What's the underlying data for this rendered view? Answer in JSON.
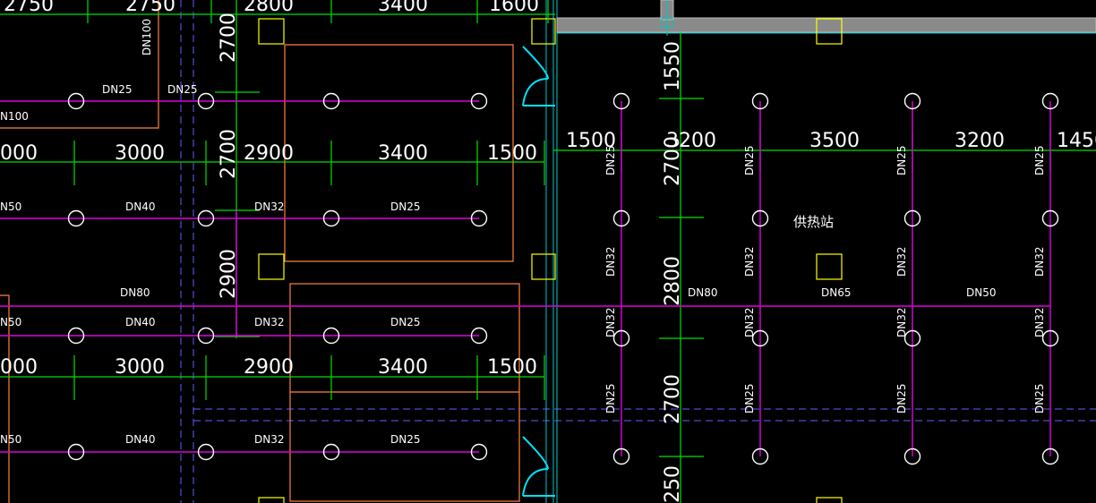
{
  "drawing": {
    "colors": {
      "background": "#000000",
      "dimension_line": "#00e000",
      "pipe": "#e000e0",
      "partition": "#ff8040",
      "column_marker": "#ffff00",
      "axis": "#00c8c8",
      "beam_dashed": "#6060ff",
      "text": "#ffffff"
    },
    "room_label": "供热站",
    "dims_row1": [
      "2750",
      "2750",
      "2800",
      "3400",
      "1600"
    ],
    "dims_row2": [
      "000",
      "3000",
      "2900",
      "3400",
      "1500"
    ],
    "dims_row3": [
      "000",
      "3000",
      "2900",
      "3400",
      "1500"
    ],
    "dims_right": [
      "1500",
      "3200",
      "3500",
      "3200",
      "1450"
    ],
    "dims_vert_left": [
      "2700",
      "2700",
      "2900"
    ],
    "dims_vert_right": [
      "1550",
      "2700",
      "2800",
      "2700",
      "250"
    ],
    "pipes": {
      "dn100_v": "DN100",
      "dn100_h": "N100",
      "top_a": "DN25",
      "top_b": "DN25",
      "row2": [
        "N50",
        "DN40",
        "DN32",
        "DN25"
      ],
      "main_left": "DN80",
      "row3": [
        "N50",
        "DN40",
        "DN32",
        "DN25"
      ],
      "row4": [
        "N50",
        "DN40",
        "DN32",
        "DN25"
      ],
      "main_right": [
        "DN80",
        "DN65",
        "DN50"
      ],
      "vert_upper": [
        "DN25",
        "DN25",
        "DN25",
        "DN25"
      ],
      "vert_mid_upper": [
        "DN32",
        "DN32",
        "DN32",
        "DN32"
      ],
      "vert_mid_lower": [
        "DN32",
        "DN32",
        "DN32",
        "DN32"
      ],
      "vert_lower": [
        "DN25",
        "DN25",
        "DN25",
        "DN25"
      ]
    }
  }
}
